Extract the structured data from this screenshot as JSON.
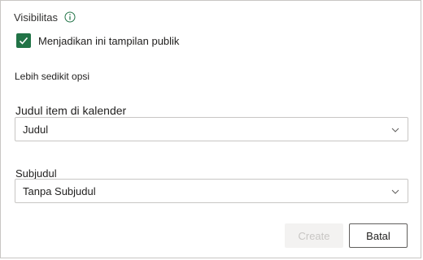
{
  "visibility": {
    "label": "Visibilitas",
    "icon": "info-icon"
  },
  "public_view": {
    "label": "Menjadikan ini tampilan publik",
    "checked": true,
    "color": "#217346"
  },
  "options": {
    "less_label": "Lebih sedikit opsi"
  },
  "title_field": {
    "label": "Judul item di kalender",
    "value": "Judul"
  },
  "subheading_field": {
    "label": "Subjudul",
    "value": "Tanpa Subjudul"
  },
  "footer": {
    "create_label": "Create",
    "cancel_label": "Batal"
  }
}
